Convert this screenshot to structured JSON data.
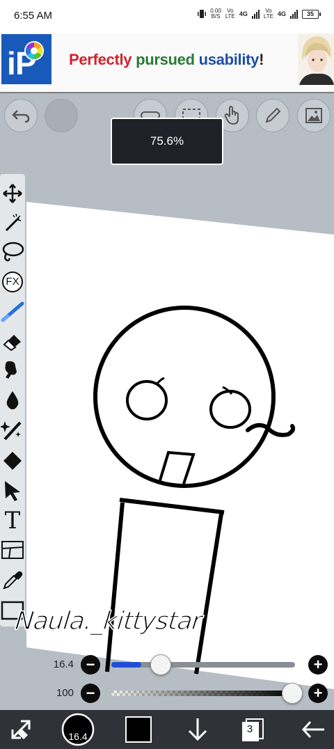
{
  "status_bar": {
    "time": "6:55 AM",
    "net_speed_top": "0.00",
    "net_speed_unit": "B/S",
    "sim1_label_top": "Vo",
    "sim1_label_bottom": "LTE",
    "sim1_gen": "4G",
    "sim2_label_top": "Vo",
    "sim2_label_bottom": "LTE",
    "sim2_gen": "4G",
    "battery": "35"
  },
  "ad_banner": {
    "logo_text": "iP",
    "word1": "Perfectly",
    "word2": "pursued",
    "word3": "usability",
    "word4": "!"
  },
  "top_toolbar": {
    "undo_icon": "undo-icon",
    "redo_icon": "redo-icon",
    "buttons": [
      "ruler-icon",
      "selection-icon",
      "hand-icon",
      "pen-icon",
      "gallery-icon"
    ]
  },
  "zoom_popup": {
    "value": "75.6%"
  },
  "left_tools": [
    "move-icon",
    "magic-wand-icon",
    "lasso-icon",
    "fx-icon",
    "brush-icon",
    "eraser-icon",
    "smudge-icon",
    "blur-icon",
    "glow-pen-icon",
    "fill-icon",
    "select-arrow-icon",
    "text-icon",
    "frame-divider-icon",
    "eyedropper-icon",
    "canvas-icon"
  ],
  "fx_label": "FX",
  "text_tool_label": "T",
  "watermark": "Naula._kittystar",
  "brush_size": {
    "value_label": "16.4",
    "level_fraction": 0.12,
    "minus": "−",
    "plus": "+"
  },
  "opacity": {
    "value_label": "100",
    "level_fraction": 1.0,
    "minus": "−",
    "plus": "+"
  },
  "bottom_bar": {
    "brush_size_label": "16.4",
    "color": "#000000",
    "layers_count": "3",
    "items": [
      "transform-icon",
      "brush-size-button",
      "color-button",
      "download-icon",
      "layers-button",
      "back-arrow-icon"
    ]
  },
  "colors": {
    "accent": "#1f4fd6",
    "toolbar_bg": "#2f3338",
    "workspace_bg": "#b6bdc4"
  }
}
